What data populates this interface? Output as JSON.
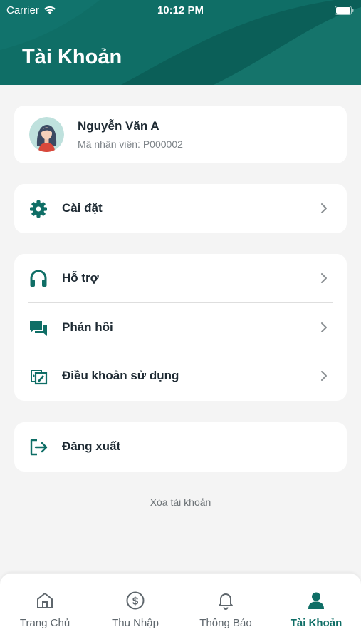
{
  "status_bar": {
    "carrier": "Carrier",
    "time": "10:12 PM"
  },
  "header": {
    "title": "Tài Khoản"
  },
  "profile": {
    "name": "Nguyễn Văn A",
    "employee_id": "Mã nhân viên: P000002"
  },
  "menu": {
    "settings": "Cài đặt",
    "support": "Hỗ trợ",
    "feedback": "Phản hồi",
    "terms": "Điều khoản sử dụng",
    "logout": "Đăng xuất"
  },
  "delete_account": "Xóa tài khoản",
  "tabs": [
    {
      "label": "Trang Chủ",
      "icon": "home-icon"
    },
    {
      "label": "Thu Nhập",
      "icon": "dollar-icon"
    },
    {
      "label": "Thông Báo",
      "icon": "bell-icon"
    },
    {
      "label": "Tài Khoản",
      "icon": "person-icon",
      "active": true
    }
  ],
  "colors": {
    "primary": "#0f6e66",
    "background": "#f4f4f4",
    "card": "#ffffff",
    "text": "#1e2a33",
    "muted": "#7d8388"
  }
}
